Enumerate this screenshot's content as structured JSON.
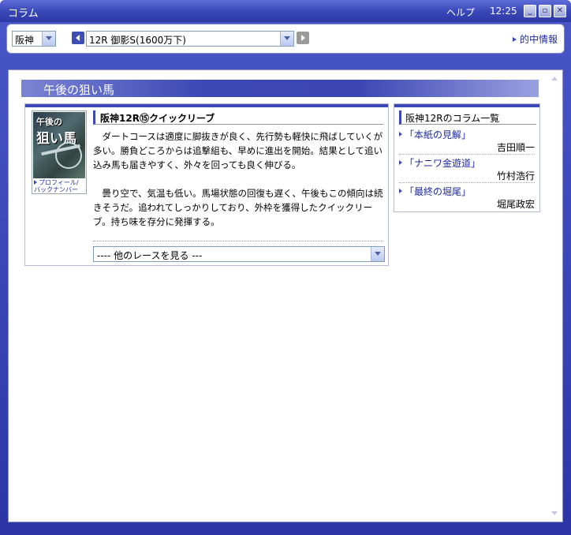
{
  "window": {
    "title": "コラム",
    "help": "ヘルプ",
    "clock": "12:25",
    "buttons": {
      "minimize": "_",
      "restore": "▫",
      "close": "✕"
    }
  },
  "toolbar": {
    "venue": "阪神",
    "race": "12R 御影S(1600万下)",
    "hit_link": "的中情報"
  },
  "section": {
    "title": "午後の狙い馬"
  },
  "thumbnail": {
    "line1": "午後の",
    "line2": "狙い馬",
    "link_line1": "プロフィール/",
    "link_line2": "バックナンバー"
  },
  "column": {
    "title": "阪神12R⑮クイックリーブ",
    "paragraph1": "ダートコースは適度に脚抜きが良く、先行勢も軽快に飛ばしていくが多い。勝負どころからは追撃組も、早めに進出を開始。結果として追い込み馬も届きやすく、外々を回っても良く伸びる。",
    "paragraph2": "曇り空で、気温も低い。馬場状態の回復も遅く、午後もこの傾向は続きそうだ。追われてしっかりしており、外枠を獲得したクイックリーブ。持ち味を存分に発揮する。",
    "other_races": "---- 他のレースを見る ---"
  },
  "side_list": {
    "title": "阪神12Rのコラム一覧",
    "items": [
      {
        "title": "「本紙の見解」",
        "author": "吉田順一"
      },
      {
        "title": "「ナニワ金遊道」",
        "author": "竹村浩行"
      },
      {
        "title": "「最終の堀尾」",
        "author": "堀尾政宏"
      }
    ]
  },
  "colors": {
    "accent": "#3c48b4",
    "link": "#1c2aa0",
    "titlebar": "#3846b6"
  },
  "icons": [
    "minimize-icon",
    "restore-icon",
    "close-icon",
    "chevron-left-icon",
    "chevron-right-icon",
    "chevron-down-icon",
    "arrow-right-icon"
  ]
}
